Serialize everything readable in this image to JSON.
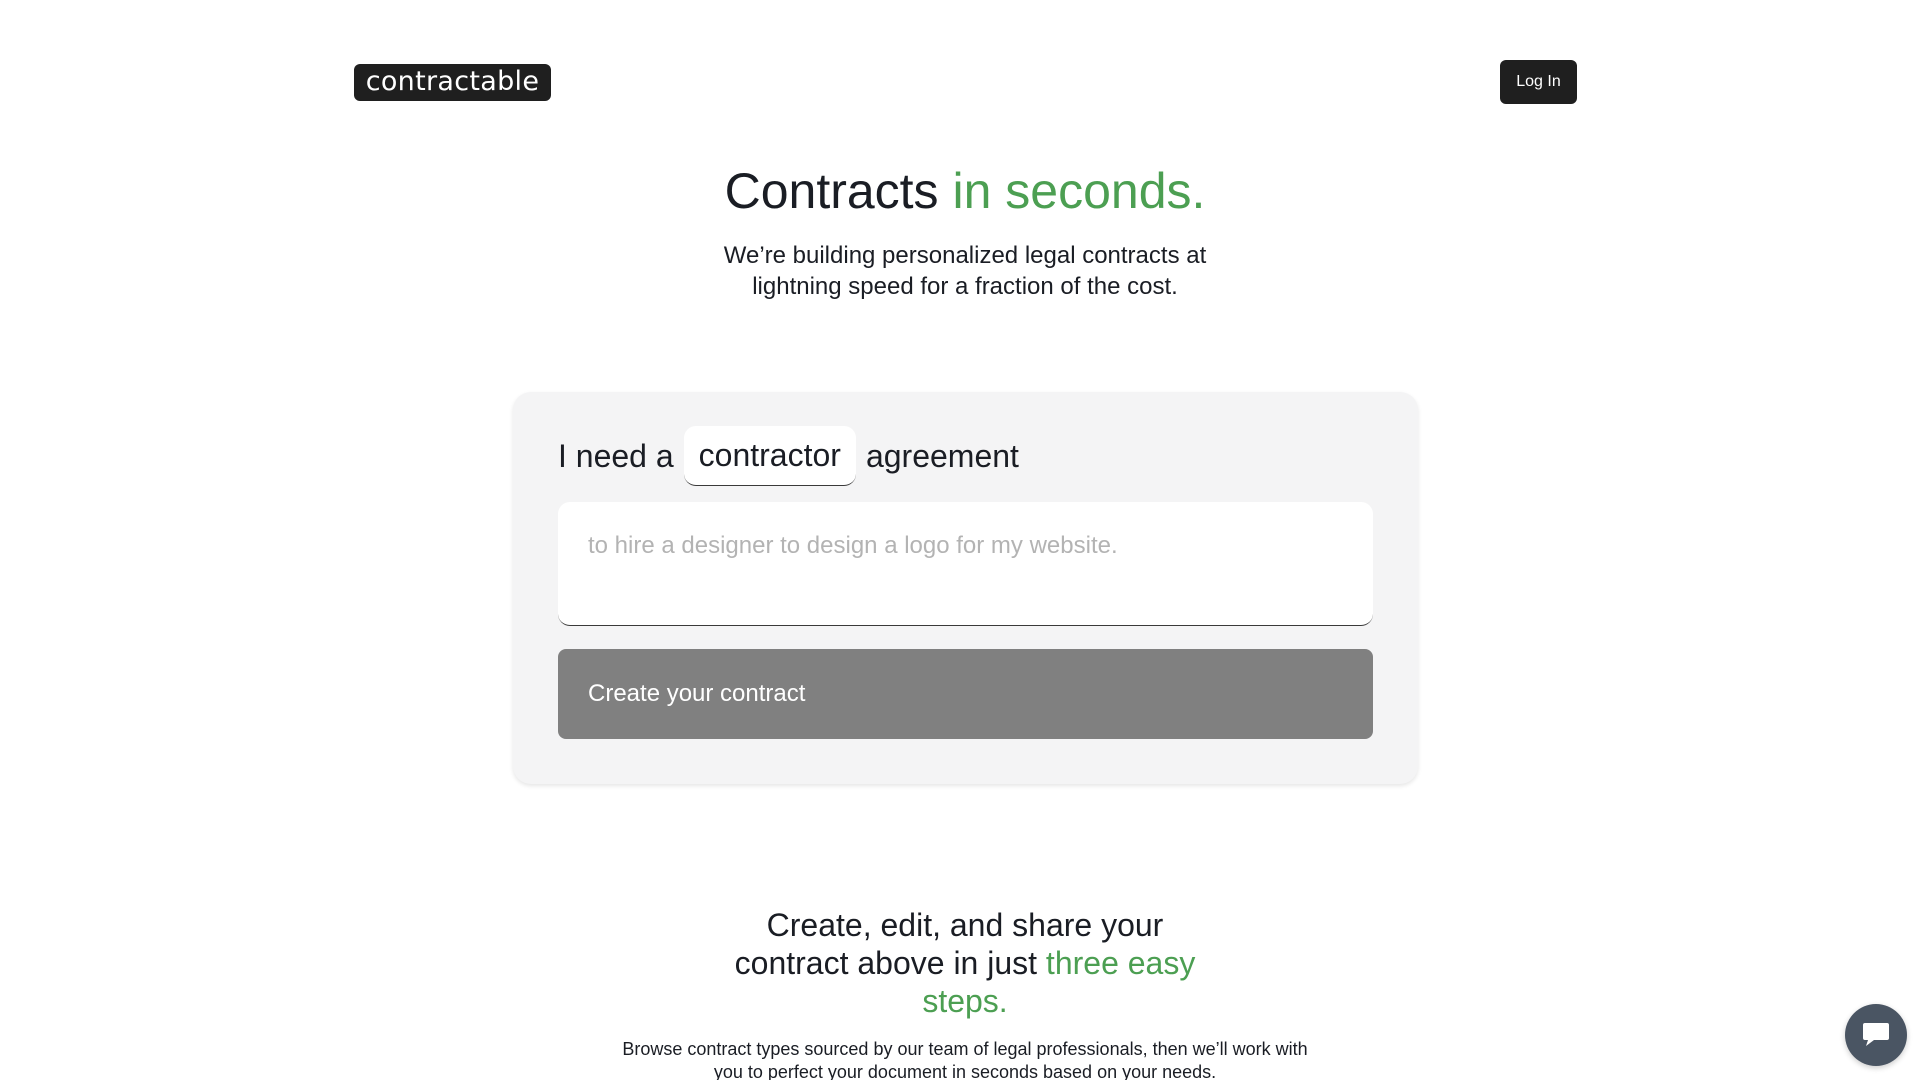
{
  "header": {
    "logo_text": "contractable",
    "login_label": "Log In"
  },
  "hero": {
    "title_part1": "Contracts",
    "title_part2": "in seconds.",
    "subtitle_line1": "We’re building personalized legal contracts at",
    "subtitle_line2": "lightning speed for a fraction of the cost."
  },
  "form": {
    "prefix": "I need a",
    "contract_type": "contractor",
    "suffix": "agreement",
    "purpose_placeholder": "to hire a designer to design a logo for my website.",
    "purpose_value": "",
    "submit_label": "Create your contract"
  },
  "steps": {
    "title_line1": "Create, edit, and share your",
    "title_line2_plain": "contract above in just",
    "title_line2_green": "three easy",
    "title_line3_green": "steps.",
    "desc_line1": "Browse contract types sourced by our team of legal professionals, then we’ll work with",
    "desc_line2": "you to perfect your document in seconds based on your needs."
  },
  "chat": {
    "icon": "chat-bubble-icon"
  },
  "colors": {
    "accent_green": "#4c9f52",
    "dark": "#1f1f1f",
    "button_disabled": "#808080",
    "card_bg": "#f4f4f5",
    "chat_bg": "#4a5563"
  }
}
